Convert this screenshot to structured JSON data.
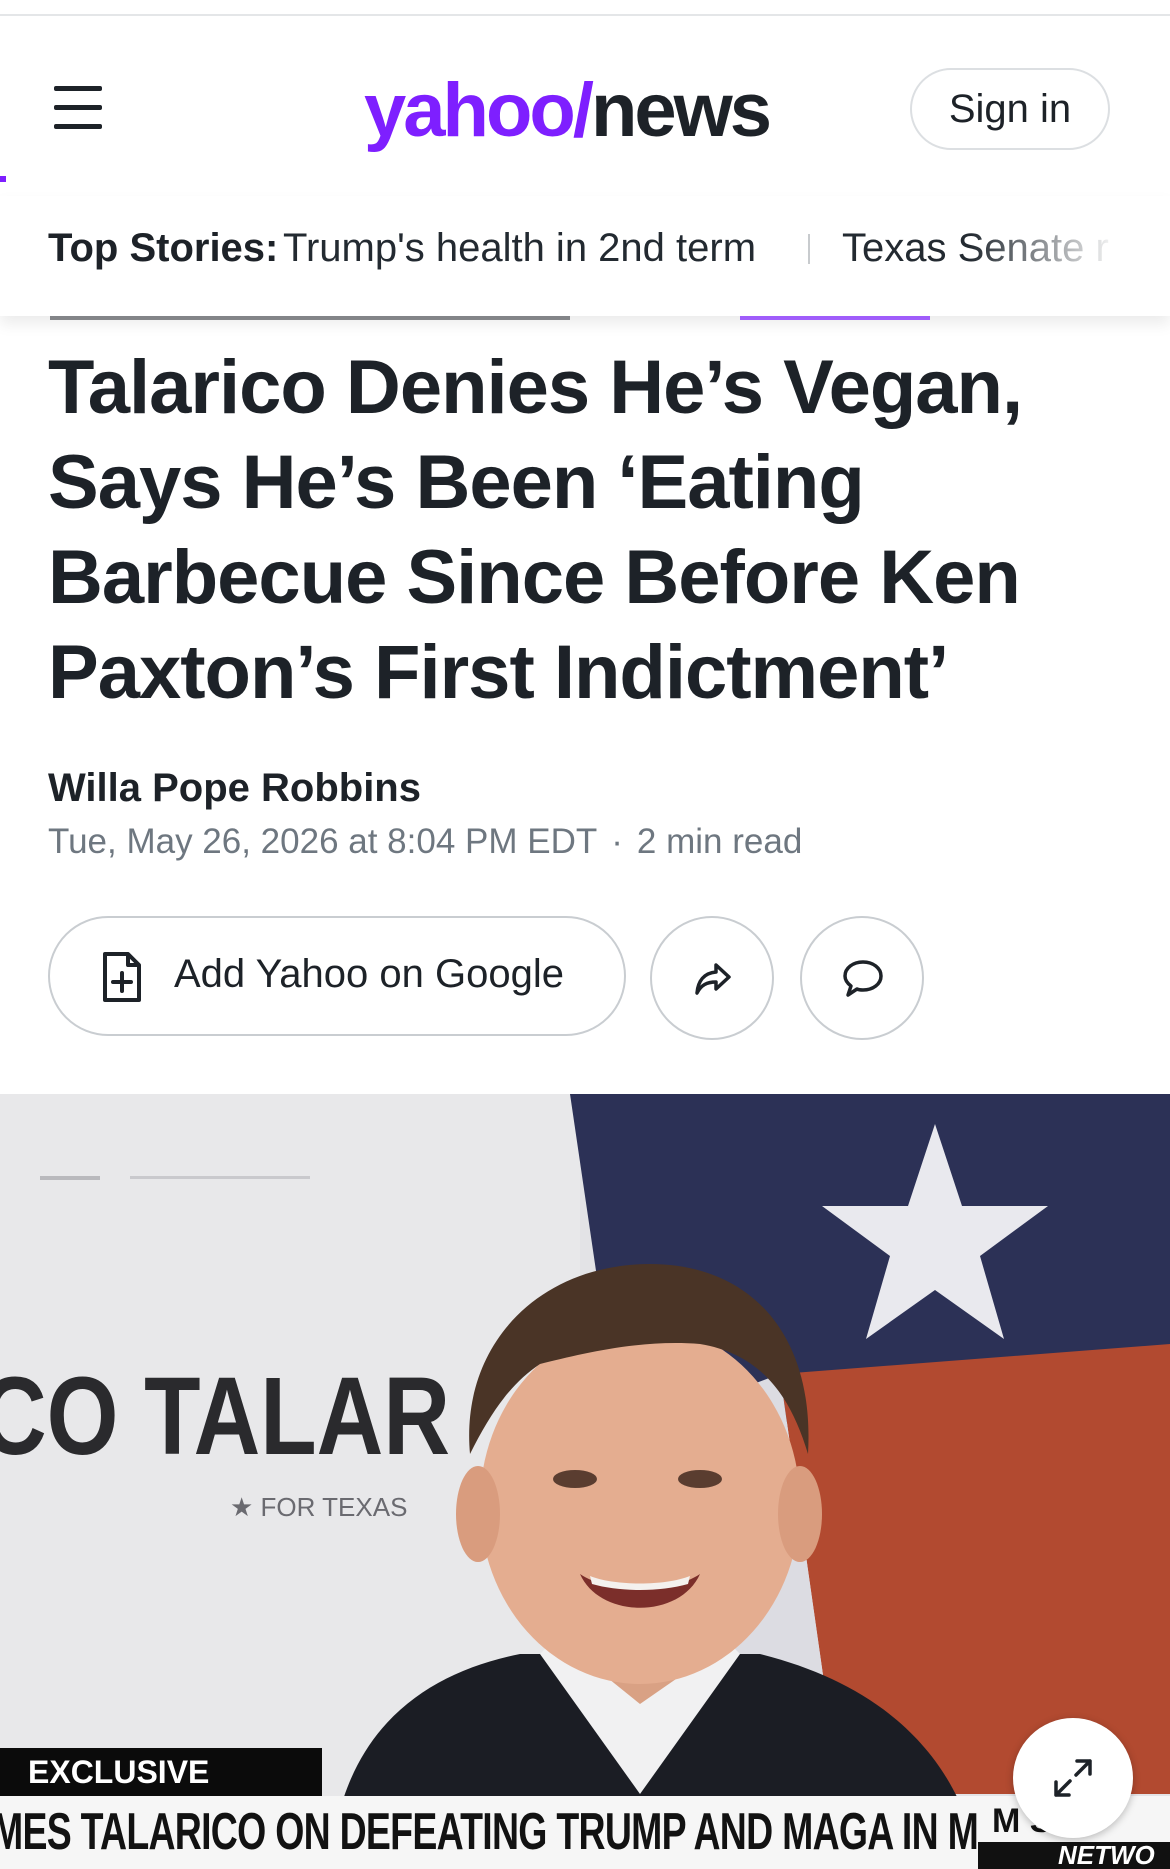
{
  "header": {
    "logo_part1": "yahoo",
    "logo_slash": "/",
    "logo_part2": "news",
    "signin_label": "Sign in"
  },
  "top_stories": {
    "label": "Top Stories:",
    "items": [
      "Trump's health in 2nd term",
      "Texas Senate r"
    ]
  },
  "article": {
    "headline": "Talarico Denies He’s Vegan, Says He’s Been ‘Eating Barbecue Since Before Ken Paxton’s First Indictment’",
    "author": "Willa Pope Robbins",
    "date": "Tue, May 26, 2026 at 8:04 PM EDT",
    "meta_separator": "·",
    "read_time": "2 min read",
    "add_google_label": "Add Yahoo on Google"
  },
  "hero": {
    "sign_text": "CO TALAR",
    "sign_subtext": "★ FOR TEXAS",
    "badge": "EXCLUSIVE",
    "chyron": "MES TALARICO ON DEFEATING TRUMP AND MAGA IN MIDTERMS",
    "chyron_right_top": "M     STO",
    "chyron_right_bottom": "NETWO"
  },
  "colors": {
    "brand_purple": "#7e1fff",
    "text_dark": "#1d2228",
    "text_muted": "#6e7780"
  },
  "icons": [
    "menu-icon",
    "add-document-icon",
    "share-icon",
    "comment-icon",
    "expand-icon"
  ]
}
